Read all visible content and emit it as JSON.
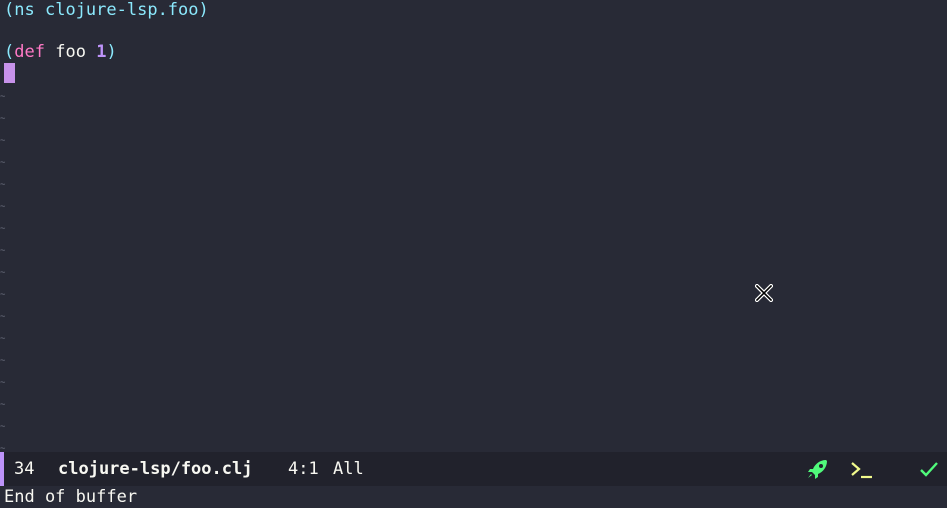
{
  "editor": {
    "ns_open": "(",
    "ns_keyword": "ns",
    "ns_name": "clojure-lsp.foo",
    "ns_close": ")",
    "def_open": "(",
    "def_keyword": "def",
    "def_symbol": "foo",
    "def_value": "1",
    "def_close": ")"
  },
  "modeline": {
    "line_count": "34",
    "file_path": "clojure-lsp/foo.clj",
    "position": "4:1",
    "scope": "All",
    "icons": [
      "rocket-icon",
      "terminal-icon",
      "check-icon"
    ]
  },
  "echo_area": {
    "message": "End of buffer"
  },
  "colors": {
    "background": "#282a36",
    "modeline_bg": "#21222c",
    "accent": "#bd93f9",
    "keyword": "#ff79c6",
    "paren": "#8be9fd",
    "success": "#50fa7b"
  }
}
